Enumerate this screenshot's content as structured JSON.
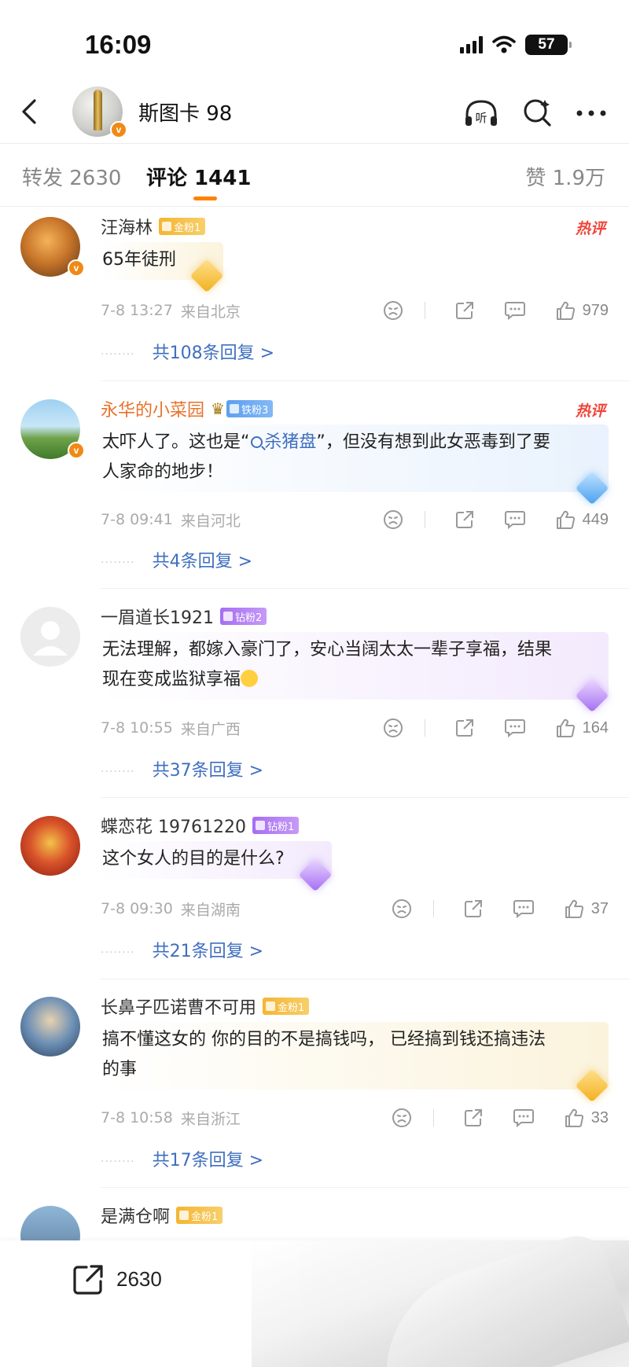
{
  "status": {
    "time": "16:09",
    "battery": "57"
  },
  "profile": {
    "name": "斯图卡 98"
  },
  "tabs": {
    "repost": "转发 2630",
    "comment": "评论 1441",
    "like": "赞 1.9万"
  },
  "comments": [
    {
      "name": "汪海林",
      "badge": "金粉1",
      "hot": "热评",
      "text": "65年徒刑",
      "time": "7-8 13:27",
      "location": "来自北京",
      "likes": "979",
      "replies": "共108条回复 >"
    },
    {
      "name": "永华的小菜园",
      "badge": "铁粉3",
      "hot": "热评",
      "text_before": "太吓人了。这也是“",
      "text_link": "杀猪盘",
      "text_after": "”，但没有想到此女恶毒到了要人家命的地步！",
      "time": "7-8 09:41",
      "location": "来自河北",
      "likes": "449",
      "replies": "共4条回复 >"
    },
    {
      "name": "一眉道长1921",
      "badge": "钻粉2",
      "text": "无法理解，都嫁入豪门了，安心当阔太太一辈子享福，结果现在变成监狱享福",
      "time": "7-8 10:55",
      "location": "来自广西",
      "likes": "164",
      "replies": "共37条回复 >"
    },
    {
      "name": "蝶恋花 19761220",
      "badge": "钻粉1",
      "text": "这个女人的目的是什么?",
      "time": "7-8 09:30",
      "location": "来自湖南",
      "likes": "37",
      "replies": "共21条回复 >"
    },
    {
      "name": "长鼻子匹诺曹不可用",
      "badge": "金粉1",
      "text": "搞不懂这女的 你的目的不是搞钱吗， 已经搞到钱还搞违法的事",
      "time": "7-8 10:58",
      "location": "来自浙江",
      "likes": "33",
      "replies": "共17条回复 >"
    },
    {
      "name": "是满仓啊",
      "badge": "金粉1"
    }
  ],
  "bottom": {
    "share_count": "2630"
  },
  "colors": {
    "accent": "#ff8200",
    "link": "#3f6fbf",
    "hot": "#f0463a",
    "name_highlight": "#e8722b"
  }
}
